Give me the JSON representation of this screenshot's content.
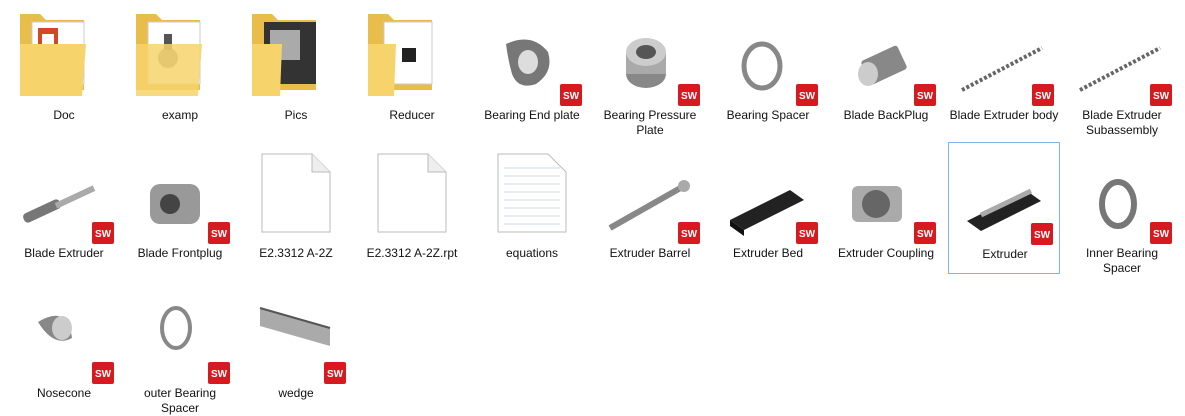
{
  "items": [
    {
      "label": "Doc",
      "icon": "folder-doc-icon",
      "kind": "folder"
    },
    {
      "label": "examp",
      "icon": "folder-examp-icon",
      "kind": "folder"
    },
    {
      "label": "Pics",
      "icon": "folder-pics-icon",
      "kind": "folder"
    },
    {
      "label": "Reducer",
      "icon": "folder-reducer-icon",
      "kind": "folder"
    },
    {
      "label": "Bearing End plate",
      "icon": "bearing-end-plate-icon",
      "kind": "part"
    },
    {
      "label": "Bearing Pressure Plate",
      "icon": "bearing-pressure-plate-icon",
      "kind": "part"
    },
    {
      "label": "Bearing Spacer",
      "icon": "ring-icon",
      "kind": "part"
    },
    {
      "label": "Blade BackPlug",
      "icon": "backplug-icon",
      "kind": "part"
    },
    {
      "label": "Blade Extruder body",
      "icon": "screw-icon",
      "kind": "part"
    },
    {
      "label": "Blade Extruder Subassembly",
      "icon": "screw-icon",
      "kind": "part"
    },
    {
      "label": "Blade Extruder",
      "icon": "shaft-icon",
      "kind": "part"
    },
    {
      "label": "Blade Frontplug",
      "icon": "frontplug-icon",
      "kind": "part"
    },
    {
      "label": "E2.3312 A-2Z",
      "icon": "blank-file-icon",
      "kind": "file"
    },
    {
      "label": "E2.3312 A-2Z.rpt",
      "icon": "blank-file-icon",
      "kind": "file"
    },
    {
      "label": "equations",
      "icon": "text-file-icon",
      "kind": "file"
    },
    {
      "label": "Extruder Barrel",
      "icon": "barrel-icon",
      "kind": "part"
    },
    {
      "label": "Extruder Bed",
      "icon": "bed-icon",
      "kind": "part"
    },
    {
      "label": "Extruder Coupling",
      "icon": "coupling-icon",
      "kind": "part"
    },
    {
      "label": "Extruder",
      "icon": "extruder-icon",
      "kind": "part"
    },
    {
      "label": "Inner Bearing Spacer",
      "icon": "ring-icon",
      "kind": "part"
    },
    {
      "label": "Nosecone",
      "icon": "nosecone-icon",
      "kind": "part"
    },
    {
      "label": "outer Bearing Spacer",
      "icon": "ring-icon",
      "kind": "part"
    },
    {
      "label": "wedge",
      "icon": "wedge-icon",
      "kind": "part"
    }
  ],
  "selected_label": "Extruder",
  "colors": {
    "selection_border": "#7eb4ea",
    "folder": "#f6d36b",
    "sw_red": "#d71920"
  }
}
